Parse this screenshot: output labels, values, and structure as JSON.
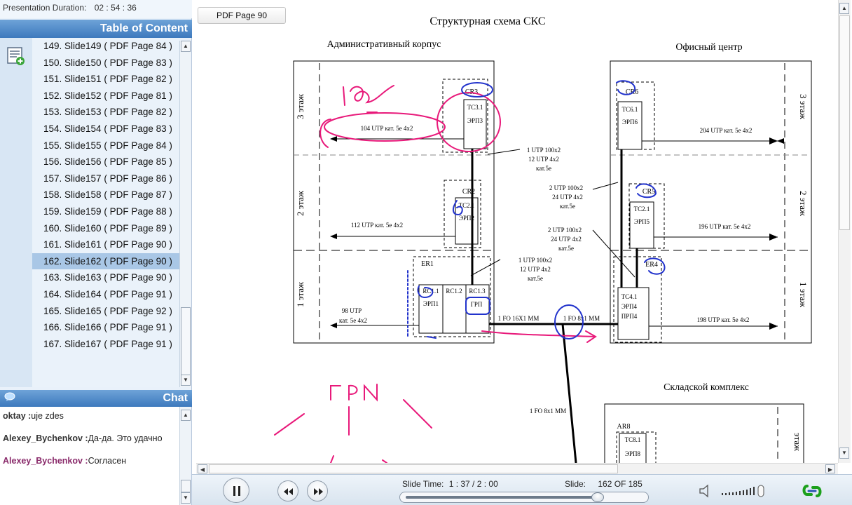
{
  "presentation": {
    "duration_label": "Presentation Duration:",
    "duration_value": "02 : 54 : 36"
  },
  "toc": {
    "title": "Table of Content",
    "items": [
      "149. Slide149 ( PDF Page 84 )",
      "150. Slide150 ( PDF Page 83 )",
      "151. Slide151 ( PDF Page 82 )",
      "152. Slide152 ( PDF Page 81 )",
      "153. Slide153 ( PDF Page 82 )",
      "154. Slide154 ( PDF Page 83 )",
      "155. Slide155 ( PDF Page 84 )",
      "156. Slide156 ( PDF Page 85 )",
      "157. Slide157 ( PDF Page 86 )",
      "158. Slide158 ( PDF Page 87 )",
      "159. Slide159 ( PDF Page 88 )",
      "160. Slide160 ( PDF Page 89 )",
      "161. Slide161 ( PDF Page 90 )",
      "162. Slide162 ( PDF Page 90 )",
      "163. Slide163 ( PDF Page 90 )",
      "164. Slide164 ( PDF Page 91 )",
      "165. Slide165 ( PDF Page 92 )",
      "166. Slide166 ( PDF Page 91 )",
      "167. Slide167 ( PDF Page 91 )"
    ],
    "selected_index": 13
  },
  "chat": {
    "title": "Chat",
    "messages": [
      {
        "user": "oktay :",
        "text": "uje zdes",
        "style": "normal"
      },
      {
        "user": "Alexey_Bychenkov :",
        "text": "Да-да. Это удачно",
        "style": "normal"
      },
      {
        "user": "Alexey_Bychenkov :",
        "text": "Согласен",
        "style": "alt"
      }
    ]
  },
  "viewer": {
    "pdf_page_button": "PDF Page 90"
  },
  "slide": {
    "title": "Структурная схема СКС",
    "building_admin": "Административный корпус",
    "building_office": "Офисный центр",
    "building_warehouse": "Складской комплекс",
    "floor3": "3 этаж",
    "floor2": "2 этаж",
    "floor1": "1 этаж",
    "floor_partial": "этаж",
    "cr3": "CR3",
    "tc31": "TC3.1",
    "erp3": "ЭРП3",
    "cr2": "CR2",
    "tc21": "TC2.1",
    "erp2": "ЭРП2",
    "er1": "ER1",
    "rc11": "RC1.1",
    "rc12": "RC1.2",
    "rc13": "RC1.3",
    "erp1": "ЭРП1",
    "grp": "ГРП",
    "cr6": "CR6",
    "tc61": "TC6.1",
    "erp6": "ЭРП6",
    "cr5": "CR5",
    "tc52": "TC2.1",
    "erp5": "ЭРП5",
    "er4": "ER4",
    "tc41": "TC4.1",
    "erp4": "ЭРП4",
    "prp4": "ПРП4",
    "ar8": "AR8",
    "tc81": "TC8.1",
    "erp8": "ЭРП8",
    "utp104": "104 UTP кат. 5е 4х2",
    "utp112": "112 UTP кат. 5е 4х2",
    "utp98a": "98 UTP",
    "utp98b": "кат. 5е 4х2",
    "utp204": "204 UTP кат. 5е 4х2",
    "utp196": "196 UTP кат. 5е 4х2",
    "utp198": "198 UTP кат. 5е 4х2",
    "link_a1": "1 UTP 100х2",
    "link_a2": "12 UTP 4х2",
    "link_a3": "кат.5е",
    "link_b1": "2 UTP 100х2",
    "link_b2": "24 UTP 4х2",
    "link_b3": "кат.5е",
    "link_c1": "2 UTP 100х2",
    "link_c2": "24 UTP 4х2",
    "link_c3": "кат.5е",
    "link_d1": "1 UTP 100х2",
    "link_d2": "12 UTP 4х2",
    "link_d3": "кат.5е",
    "fo16": "1 FO 16X1 MM",
    "fo8a": "1 FO 8x1 MM",
    "fo8b": "1 FO 8x1 MM",
    "annot_grp": "ГРП"
  },
  "player": {
    "slide_time_label": "Slide Time:",
    "slide_time_value": "1 : 37 / 2 : 00",
    "slide_label": "Slide:",
    "slide_value": "162 OF 185",
    "progress": 0.81
  },
  "colors": {
    "accent": "#3d79bd",
    "annot_pink": "#e8197a",
    "annot_blue": "#2233cc"
  }
}
